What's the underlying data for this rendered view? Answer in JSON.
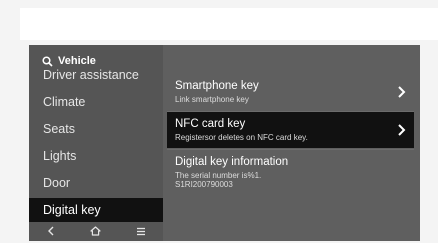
{
  "sidebar": {
    "header": "Vehicle",
    "items": [
      {
        "label": "Driver assistance"
      },
      {
        "label": "Climate"
      },
      {
        "label": "Seats"
      },
      {
        "label": "Lights"
      },
      {
        "label": "Door"
      },
      {
        "label": "Digital key"
      }
    ]
  },
  "panel": {
    "rows": [
      {
        "title": "Smartphone key",
        "subtitle": "Link smartphone key"
      },
      {
        "title": "NFC card key",
        "subtitle": "Registersor deletes on NFC card key."
      },
      {
        "title": "Digital key information",
        "subtitle_line1": "The serial number is%1.",
        "subtitle_line2": "S1RI200790003"
      }
    ]
  },
  "icons": {
    "header": "search-icon",
    "nav": [
      "back-icon",
      "home-icon",
      "menu-icon"
    ],
    "row_action": "chevron-right-icon"
  },
  "colors": {
    "screen_bg": "#5f5f5f",
    "sidebar_bg": "#555555",
    "selected_bg": "#111111",
    "text": "#ffffff"
  }
}
